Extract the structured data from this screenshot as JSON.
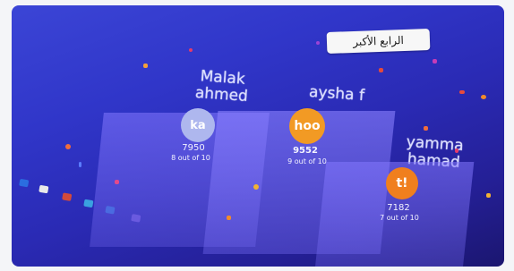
{
  "title": "الرابع الأكبر",
  "leaderboard": [
    {
      "name_line1": "Malak",
      "name_line2": "ahmed",
      "avatar": "ka",
      "avatar_color": "#aeb7ee",
      "score": "7950",
      "detail": "8 out of 10"
    },
    {
      "name_line1": "aysha f",
      "name_line2": "",
      "avatar": "hoo",
      "avatar_color": "#f29a24",
      "score": "9552",
      "detail": "9 out of 10"
    },
    {
      "name_line1": "yamma",
      "name_line2": "hamad",
      "avatar": "t!",
      "avatar_color": "#f07f1e",
      "score": "7182",
      "detail": "7 out of 10"
    }
  ],
  "colors": {
    "accent": "#3036c9",
    "podium": "#7f6ff0"
  }
}
